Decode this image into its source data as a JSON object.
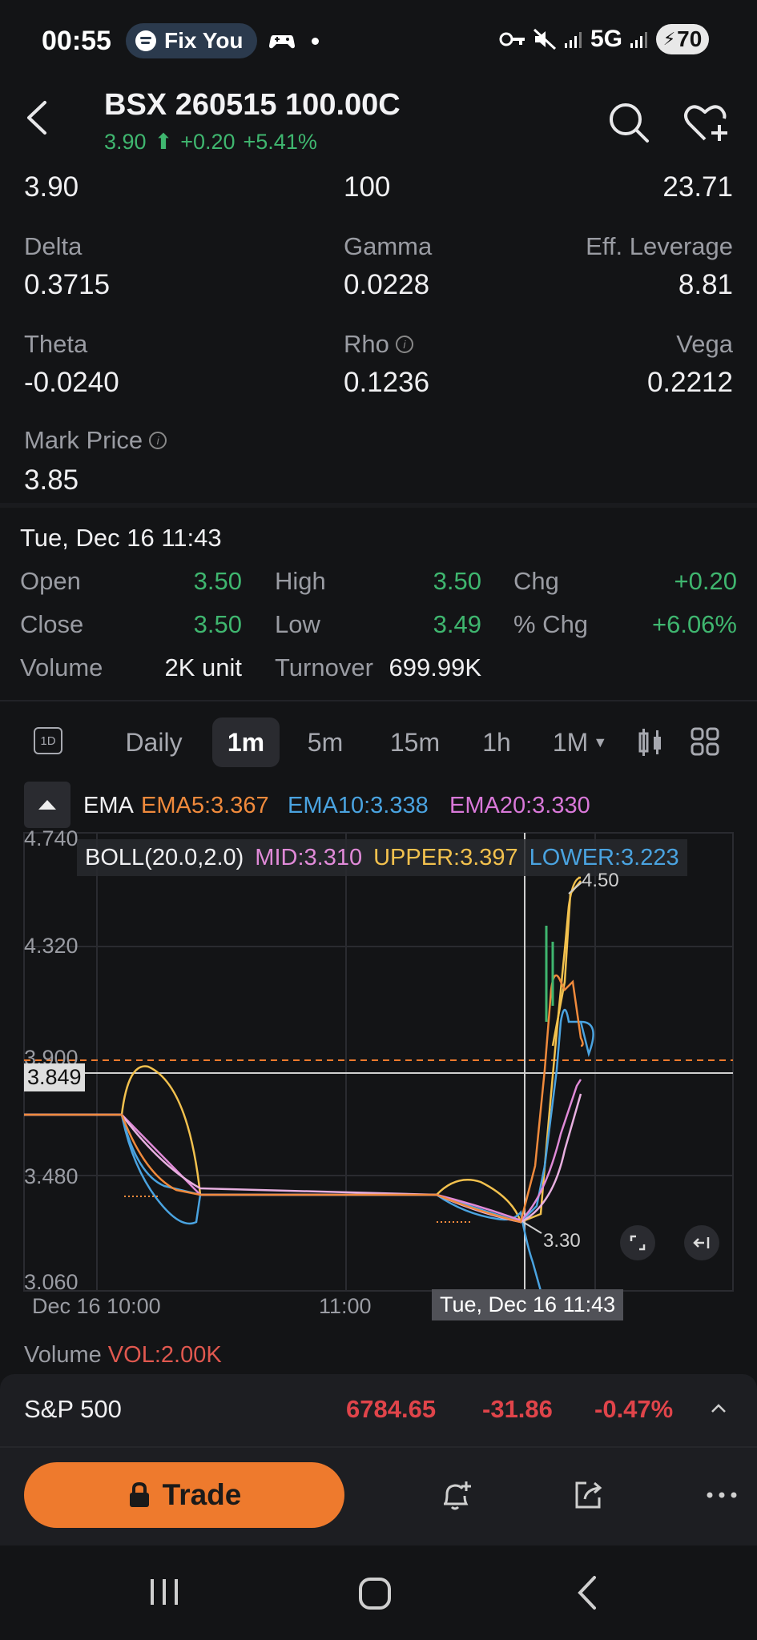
{
  "status_bar": {
    "time": "00:55",
    "now_playing": "Fix You",
    "network": "5G",
    "battery": "70"
  },
  "header": {
    "title": "BSX 260515 100.00C",
    "price": "3.90",
    "change": "+0.20",
    "change_pct": "+5.41%"
  },
  "greeks": {
    "row0": [
      "3.90",
      "100",
      "23.71"
    ],
    "delta_label": "Delta",
    "delta": "0.3715",
    "gamma_label": "Gamma",
    "gamma": "0.0228",
    "lev_label": "Eff. Leverage",
    "lev": "8.81",
    "theta_label": "Theta",
    "theta": "-0.0240",
    "rho_label": "Rho",
    "rho": "0.1236",
    "vega_label": "Vega",
    "vega": "0.2212",
    "mark_label": "Mark Price",
    "mark": "3.85"
  },
  "ohlc": {
    "date": "Tue, Dec 16 11:43",
    "open_label": "Open",
    "open": "3.50",
    "high_label": "High",
    "high": "3.50",
    "chg_label": "Chg",
    "chg": "+0.20",
    "close_label": "Close",
    "close": "3.50",
    "low_label": "Low",
    "low": "3.49",
    "pchg_label": "% Chg",
    "pchg": "+6.06%",
    "volume_label": "Volume",
    "volume": "2K unit",
    "turnover_label": "Turnover",
    "turnover": "699.99K"
  },
  "tabs": {
    "d1_icon": "1D",
    "items": [
      "Daily",
      "1m",
      "5m",
      "15m",
      "1h",
      "1M"
    ],
    "active": "1m"
  },
  "indicators": {
    "ema": "EMA",
    "ema5": "EMA5:3.367",
    "ema10": "EMA10:3.338",
    "ema20": "EMA20:3.330",
    "boll": "BOLL(20.0,2.0)",
    "mid": "MID:3.310",
    "upper": "UPPER:3.397",
    "lower": "LOWER:3.223",
    "colors": {
      "ema5": "#f08a3c",
      "ema10": "#4aa3e0",
      "ema20": "#d978d9",
      "mid": "#e08ad8",
      "upper": "#f2c14e",
      "lower": "#4aa3e0"
    }
  },
  "chart": {
    "y_ticks": [
      "4.740",
      "4.320",
      "3.900",
      "3.480",
      "3.060"
    ],
    "crosshair_price": "3.849",
    "x_ticks": [
      "Dec 16 10:00",
      "11:00"
    ],
    "crosshair_time": "Tue, Dec 16 11:43",
    "high_marker": "4.50",
    "low_marker": "3.30"
  },
  "volume": {
    "label": "Volume",
    "value": "VOL:2.00K"
  },
  "index": {
    "name": "S&P 500",
    "price": "6784.65",
    "change": "-31.86",
    "change_pct": "-0.47%"
  },
  "actions": {
    "trade": "Trade"
  }
}
